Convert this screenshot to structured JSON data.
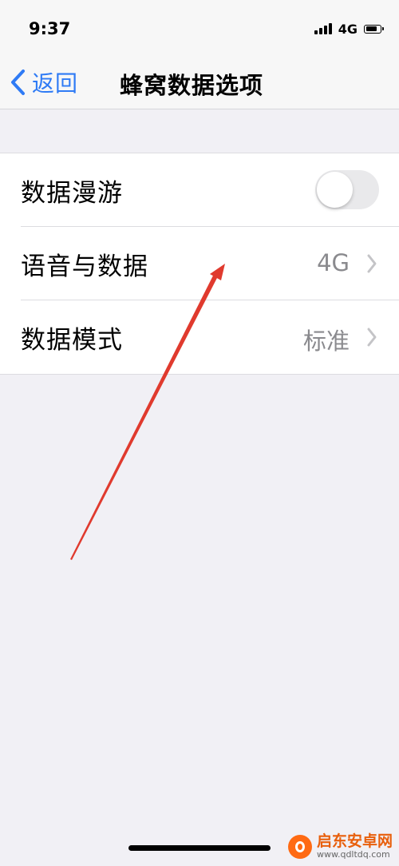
{
  "status_bar": {
    "time": "9:37",
    "network": "4G",
    "signal_level": 4,
    "battery_level": 0.8
  },
  "nav": {
    "back_label": "返回",
    "back_icon": "chevron-left-icon",
    "title": "蜂窝数据选项",
    "accent_color": "#2f7bf5"
  },
  "settings": {
    "roaming": {
      "label": "数据漫游",
      "enabled": false
    },
    "voice_data": {
      "label": "语音与数据",
      "value": "4G"
    },
    "data_mode": {
      "label": "数据模式",
      "value": "标准"
    }
  },
  "watermark": {
    "name": "启东安卓网",
    "url": "www.qdltdq.com"
  }
}
